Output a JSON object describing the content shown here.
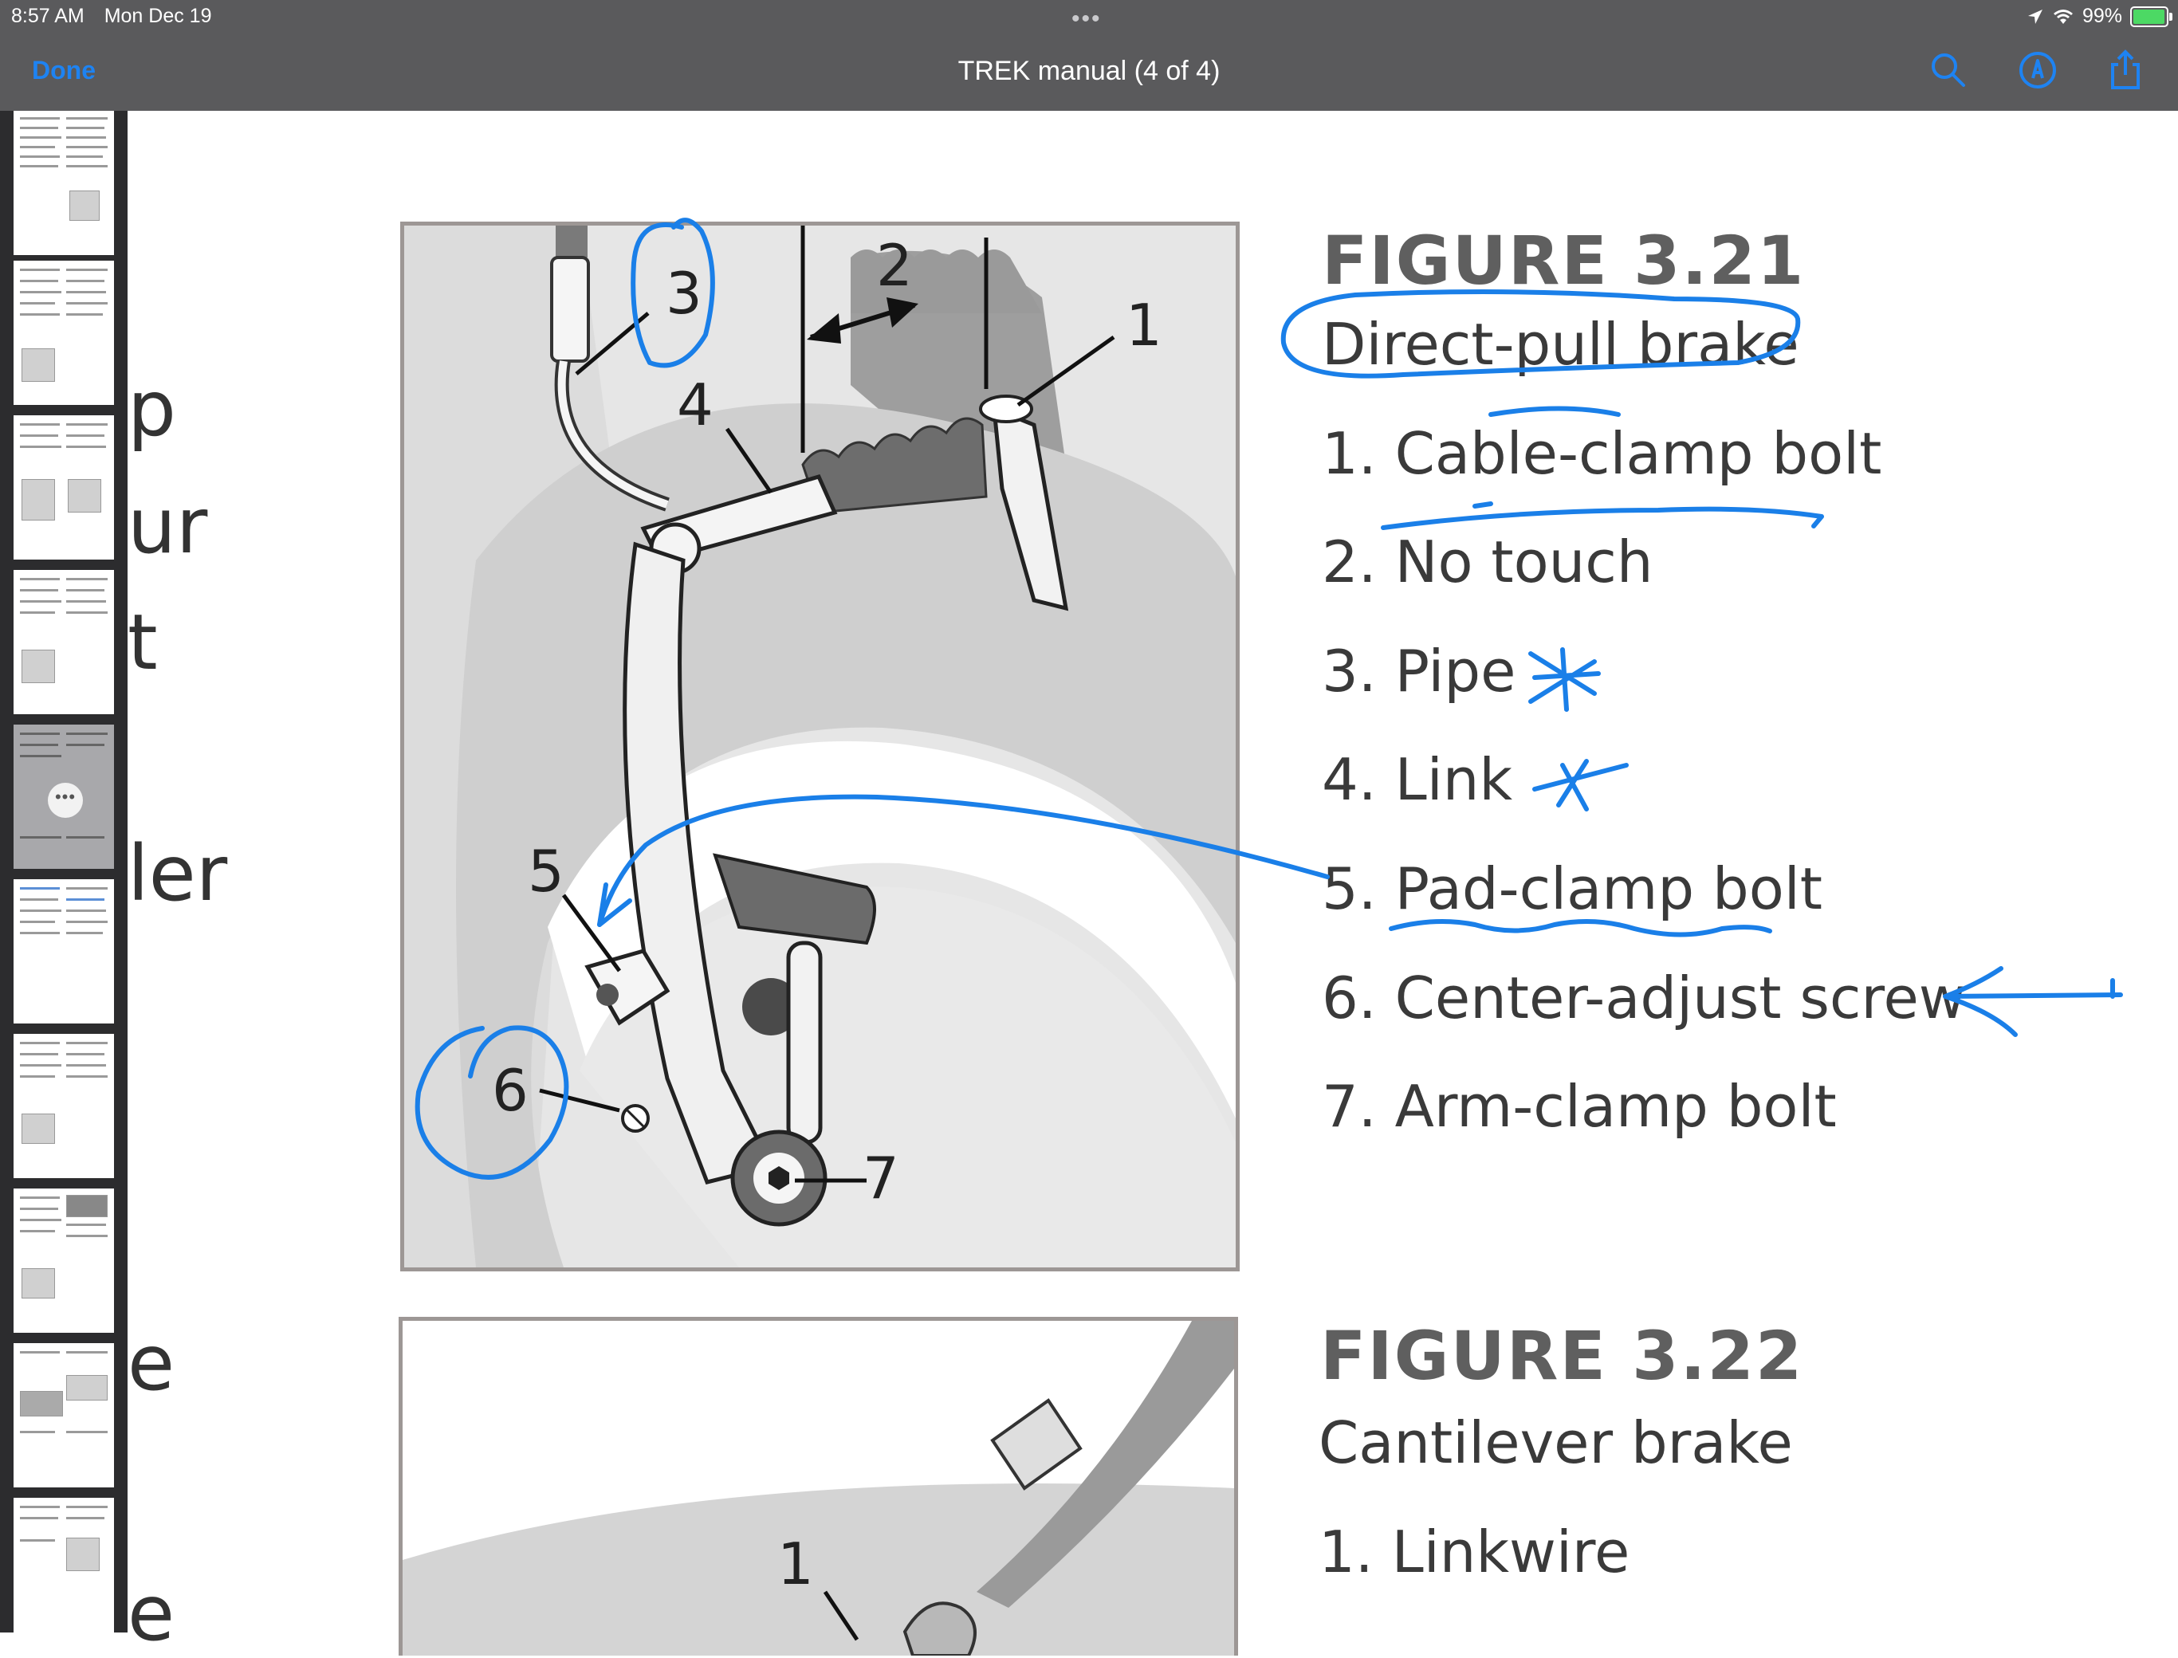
{
  "status_bar": {
    "time": "8:57 AM",
    "date": "Mon Dec 19",
    "battery": "99%"
  },
  "toolbar": {
    "done_label": "Done",
    "title": "TREK manual (4 of 4)",
    "icons": [
      "search-icon",
      "markup-icon",
      "share-icon"
    ],
    "accent_color": "#1e83f2"
  },
  "sidebar": {
    "thumbnail_count": 10,
    "selected_index": 4
  },
  "background_page_fragments": [
    "p",
    "ur",
    "t",
    "ler",
    "e",
    "e"
  ],
  "figure_321": {
    "heading": "FIGURE 3.21",
    "subtitle": "Direct-pull brake",
    "items": [
      "1. Cable-clamp bolt",
      "2. No touch",
      "3. Pipe",
      "4. Link",
      "5. Pad-clamp bolt",
      "6. Center-adjust screw",
      "7. Arm-clamp bolt"
    ],
    "callouts": [
      "1",
      "2",
      "3",
      "4",
      "5",
      "6",
      "7"
    ]
  },
  "figure_322": {
    "heading": "FIGURE 3.22",
    "subtitle": "Cantilever brake",
    "items": [
      "1. Linkwire"
    ],
    "callouts": [
      "1"
    ]
  },
  "annotation_color": "#1a7fe8"
}
